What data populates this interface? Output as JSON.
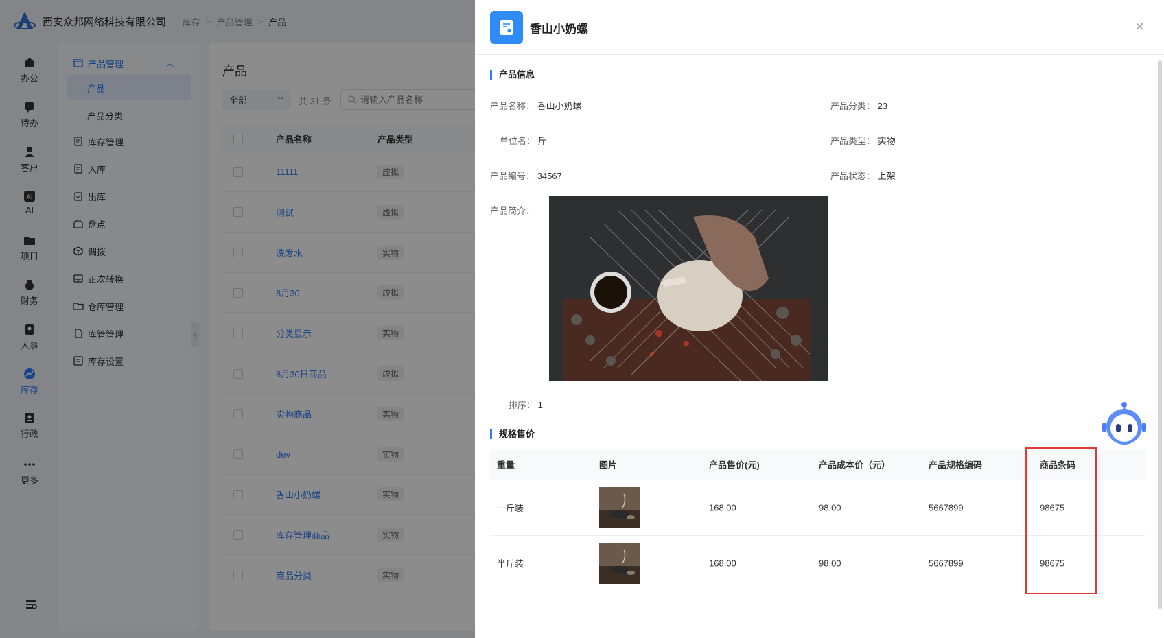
{
  "topbar": {
    "company": "西安众邦网络科技有限公司",
    "breadcrumb": [
      "库存",
      "产品管理",
      "产品"
    ]
  },
  "rail": [
    {
      "label": "办公",
      "icon": "home-icon"
    },
    {
      "label": "待办",
      "icon": "chat-icon"
    },
    {
      "label": "客户",
      "icon": "user-icon"
    },
    {
      "label": "AI",
      "icon": "ai-icon"
    },
    {
      "label": "项目",
      "icon": "folder-icon"
    },
    {
      "label": "财务",
      "icon": "money-bag-icon"
    },
    {
      "label": "人事",
      "icon": "badge-icon"
    },
    {
      "label": "库存",
      "icon": "chart-icon",
      "active": true
    },
    {
      "label": "行政",
      "icon": "id-card-icon"
    },
    {
      "label": "更多",
      "icon": "more-icon"
    }
  ],
  "menu": {
    "group": "产品管理",
    "subitems": [
      "产品",
      "产品分类"
    ],
    "items": [
      "库存管理",
      "入库",
      "出库",
      "盘点",
      "调拨",
      "正次转换",
      "仓库管理",
      "库管管理",
      "库存设置"
    ]
  },
  "list": {
    "title": "产品",
    "filter": "全部",
    "count": "共 31 条",
    "search_placeholder": "请输入产品名称",
    "headers": {
      "name": "产品名称",
      "type": "产品类型"
    },
    "rows": [
      {
        "name": "11111",
        "type": "虚拟"
      },
      {
        "name": "测试",
        "type": "虚拟"
      },
      {
        "name": "洗发水",
        "type": "实物"
      },
      {
        "name": "8月30",
        "type": "虚拟"
      },
      {
        "name": "分类显示",
        "type": "实物"
      },
      {
        "name": "8月30日商品",
        "type": "虚拟"
      },
      {
        "name": "实物商品",
        "type": "实物"
      },
      {
        "name": "dev",
        "type": "实物"
      },
      {
        "name": "香山小奶螺",
        "type": "实物"
      },
      {
        "name": "库存管理商品",
        "type": "实物"
      },
      {
        "name": "商品分类",
        "type": "实物"
      }
    ]
  },
  "drawer": {
    "title": "香山小奶螺",
    "close": "×",
    "section_info": "产品信息",
    "fields": {
      "name": {
        "label": "产品名称：",
        "value": "香山小奶螺"
      },
      "category": {
        "label": "产品分类：",
        "value": "23"
      },
      "unit": {
        "label": "单位名：",
        "value": "斤"
      },
      "ptype": {
        "label": "产品类型：",
        "value": "实物"
      },
      "code": {
        "label": "产品编号：",
        "value": "34567"
      },
      "status": {
        "label": "产品状态：",
        "value": "上架"
      },
      "intro": {
        "label": "产品简介："
      },
      "sort": {
        "label": "排序：",
        "value": "1"
      }
    },
    "section_spec": "规格售价",
    "spec_headers": [
      "重量",
      "图片",
      "产品售价(元)",
      "产品成本价（元）",
      "产品规格编码",
      "商品条码"
    ],
    "spec_rows": [
      {
        "weight": "一斤装",
        "price": "168.00",
        "cost": "98.00",
        "sku": "5667899",
        "barcode": "98675"
      },
      {
        "weight": "半斤装",
        "price": "168.00",
        "cost": "98.00",
        "sku": "5667899",
        "barcode": "98675"
      }
    ]
  },
  "colors": {
    "accent": "#2f7cf6",
    "highlight": "#e53935",
    "drawer_icon": "#2f8cf4"
  }
}
